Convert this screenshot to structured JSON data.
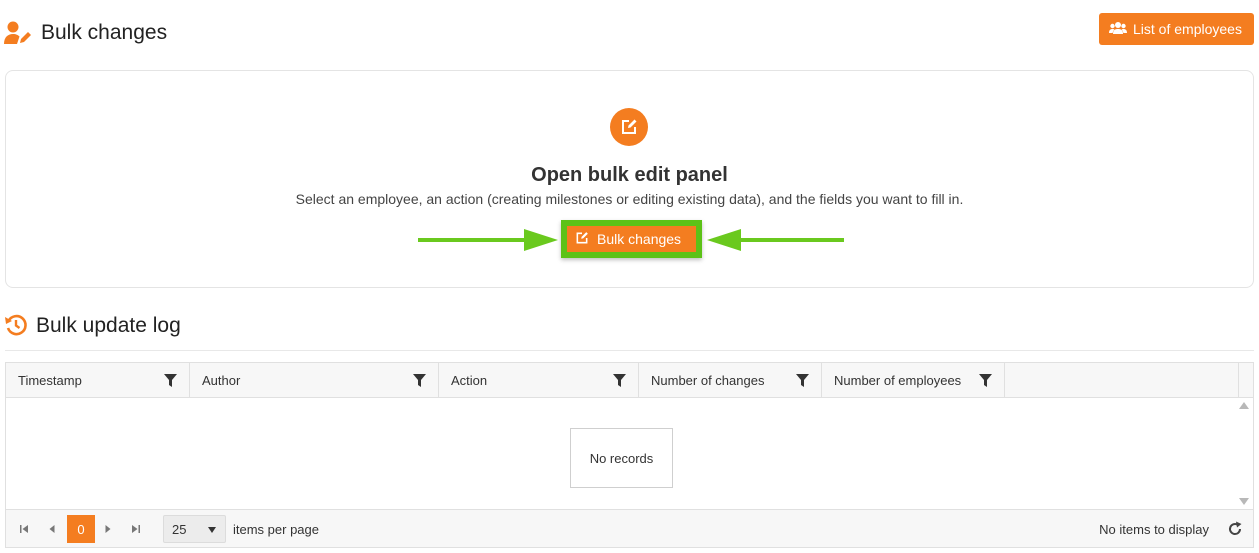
{
  "header": {
    "title": "Bulk changes",
    "title_icon": "user-edit-icon",
    "list_button_label": "List of employees",
    "list_button_icon": "users-icon"
  },
  "panel": {
    "icon": "edit-icon",
    "heading": "Open bulk edit panel",
    "description": "Select an employee, an action (creating milestones or editing existing data), and the fields you want to fill in.",
    "button_label": "Bulk changes",
    "button_icon": "edit-icon",
    "highlight_color": "#5cc217",
    "arrow_color": "#6ac91e"
  },
  "log": {
    "title": "Bulk update log",
    "title_icon": "history-icon",
    "columns": [
      "Timestamp",
      "Author",
      "Action",
      "Number of changes",
      "Number of employees"
    ],
    "empty_text": "No records"
  },
  "pager": {
    "current_page": "0",
    "page_size": "25",
    "items_per_page_label": "items per page",
    "status_text": "No items to display"
  },
  "colors": {
    "accent": "#f47d20"
  }
}
